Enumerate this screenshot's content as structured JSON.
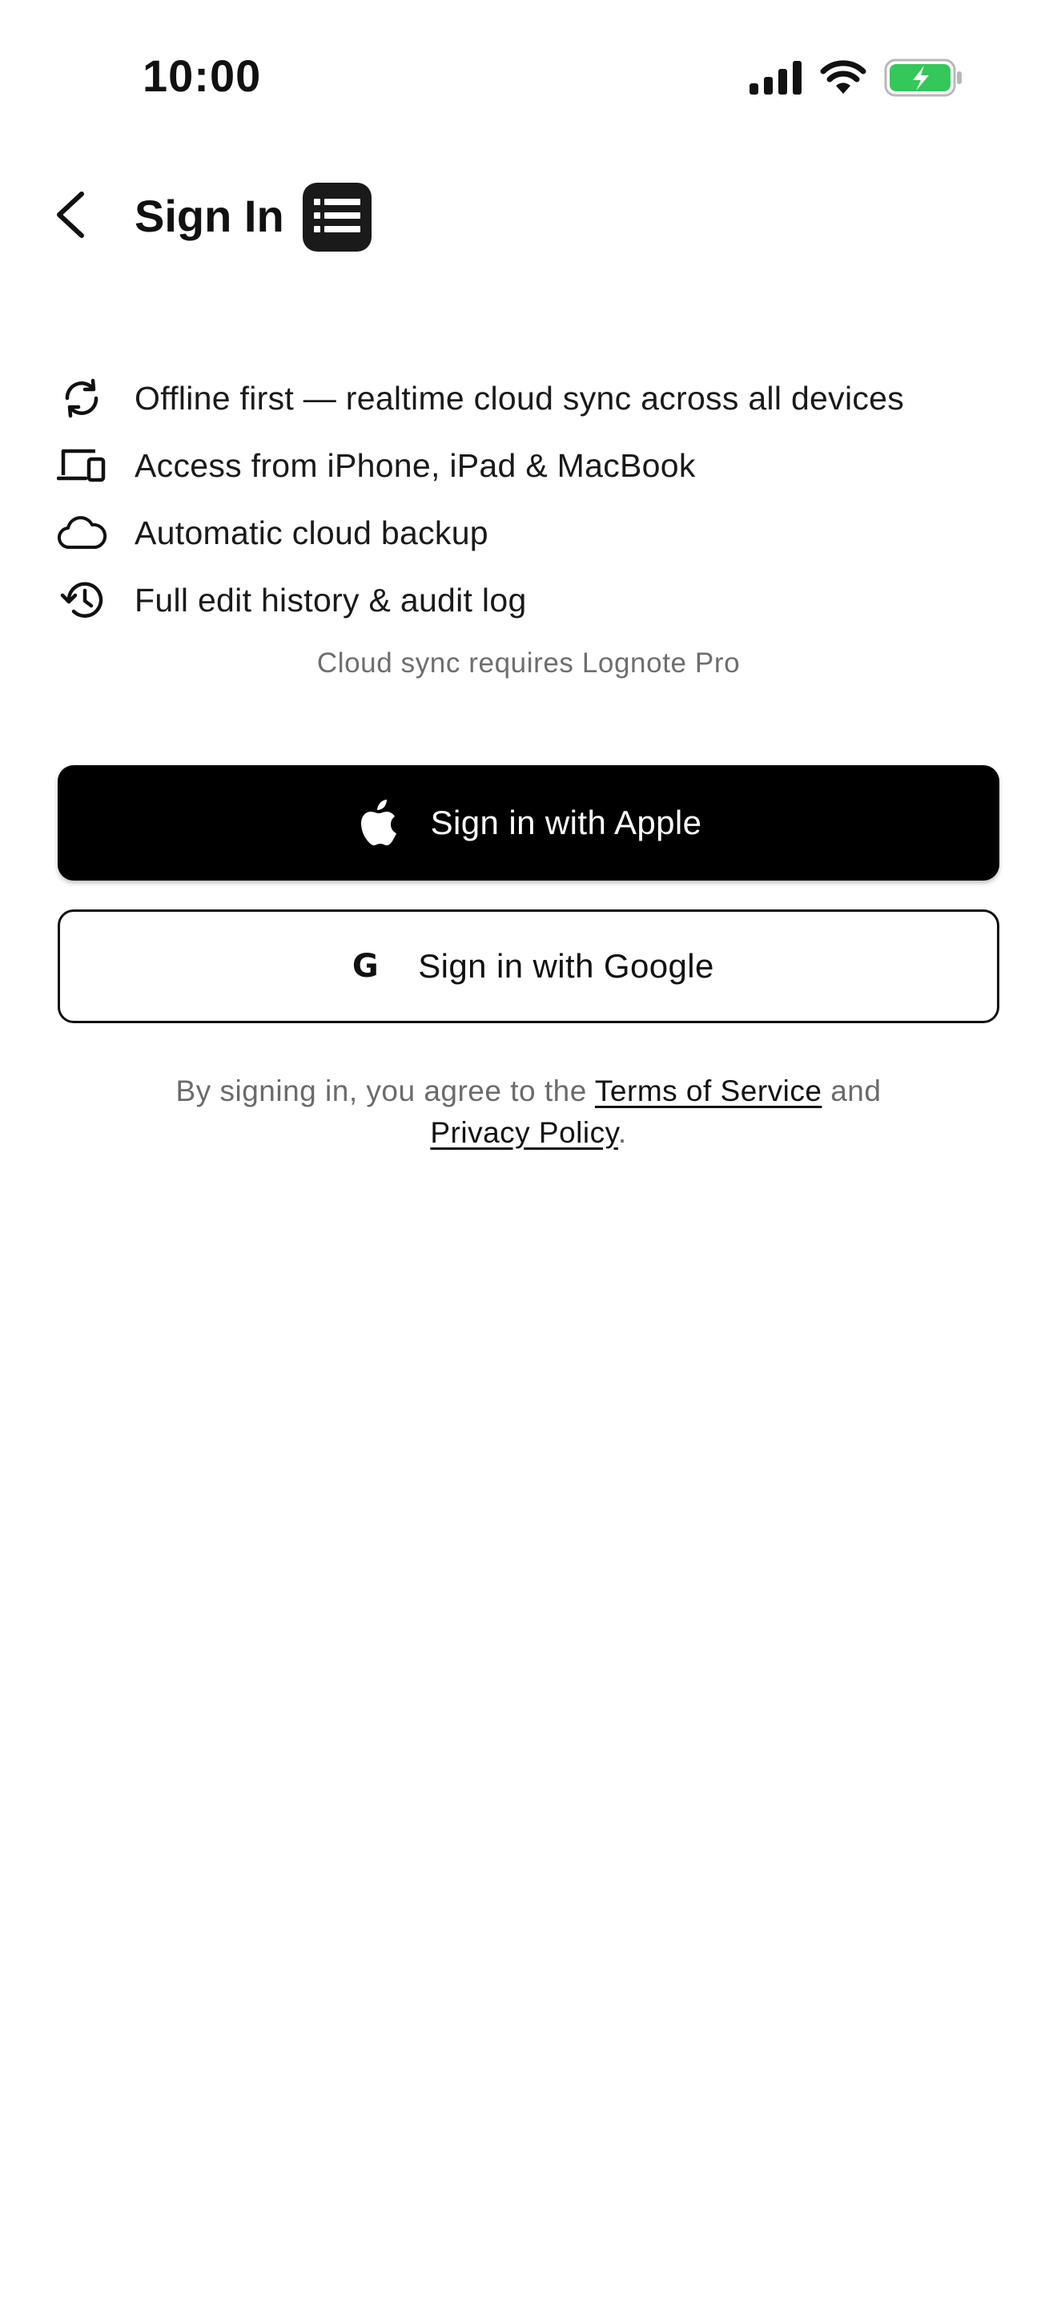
{
  "status_bar": {
    "time": "10:00",
    "icons": [
      "cellular-signal-icon",
      "wifi-icon",
      "battery-charging-icon"
    ],
    "battery_color": "#34c759"
  },
  "header": {
    "title": "Sign In",
    "back_icon": "chevron-left-icon",
    "logo_icon": "list-icon"
  },
  "features": [
    {
      "icon": "sync-icon",
      "text": "Offline first — realtime cloud sync across all devices"
    },
    {
      "icon": "devices-icon",
      "text": "Access from iPhone, iPad & MacBook"
    },
    {
      "icon": "cloud-icon",
      "text": "Automatic cloud backup"
    },
    {
      "icon": "history-icon",
      "text": "Full edit history & audit log"
    }
  ],
  "pro_note": "Cloud sync requires Lognote Pro",
  "buttons": {
    "apple": {
      "label": "Sign in with Apple",
      "icon": "apple-icon",
      "background": "#000000",
      "text_color": "#ffffff"
    },
    "google": {
      "label": "Sign in with Google",
      "icon": "google-icon",
      "icon_glyph": "G",
      "background": "#ffffff",
      "text_color": "#111111"
    }
  },
  "legal": {
    "prefix": "By signing in, you agree to the",
    "terms_link": "Terms of Service",
    "middle": "and",
    "privacy_link": "Privacy Policy",
    "suffix": "."
  }
}
